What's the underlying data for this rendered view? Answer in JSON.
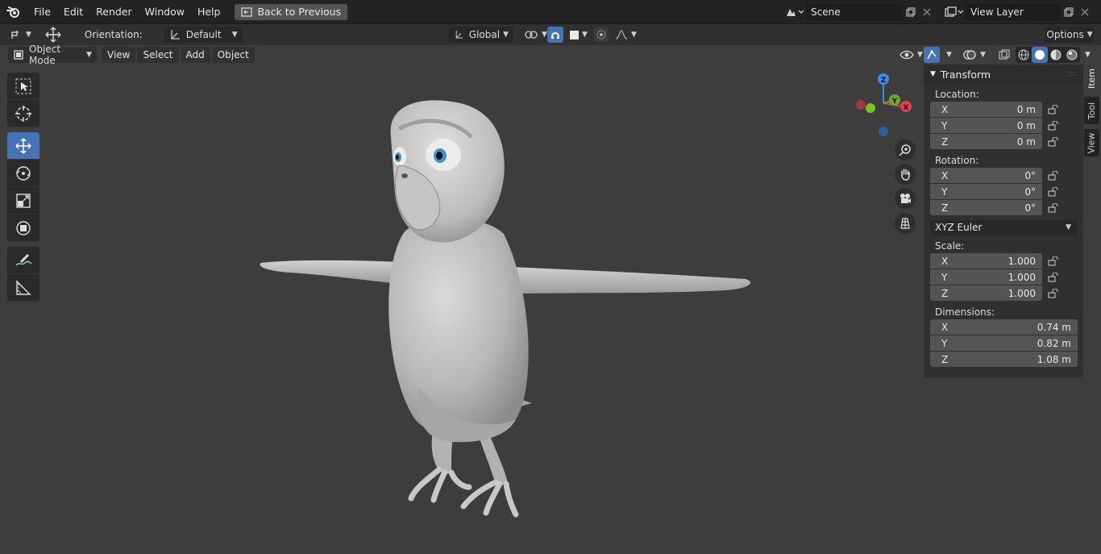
{
  "topbar": {
    "menus": [
      "File",
      "Edit",
      "Render",
      "Window",
      "Help"
    ],
    "back_button": "Back to Previous",
    "scene_value": "Scene",
    "view_layer_value": "View Layer"
  },
  "tool_header": {
    "orientation_label": "Orientation:",
    "orientation_value": "Default",
    "transform_space": "Global",
    "options_label": "Options"
  },
  "viewport_header": {
    "mode": "Object Mode",
    "menus": [
      "View",
      "Select",
      "Add",
      "Object"
    ]
  },
  "gizmo": {
    "z": "Z",
    "y": "Y",
    "x": "X"
  },
  "npanel": {
    "title": "Transform",
    "location_label": "Location:",
    "location": [
      {
        "axis": "X",
        "value": "0 m"
      },
      {
        "axis": "Y",
        "value": "0 m"
      },
      {
        "axis": "Z",
        "value": "0 m"
      }
    ],
    "rotation_label": "Rotation:",
    "rotation": [
      {
        "axis": "X",
        "value": "0°"
      },
      {
        "axis": "Y",
        "value": "0°"
      },
      {
        "axis": "Z",
        "value": "0°"
      }
    ],
    "rotation_mode": "XYZ Euler",
    "scale_label": "Scale:",
    "scale": [
      {
        "axis": "X",
        "value": "1.000"
      },
      {
        "axis": "Y",
        "value": "1.000"
      },
      {
        "axis": "Z",
        "value": "1.000"
      }
    ],
    "dimensions_label": "Dimensions:",
    "dimensions": [
      {
        "axis": "X",
        "value": "0.74 m"
      },
      {
        "axis": "Y",
        "value": "0.82 m"
      },
      {
        "axis": "Z",
        "value": "1.08 m"
      }
    ]
  },
  "side_tabs": [
    "Item",
    "Tool",
    "View"
  ],
  "icons": {
    "toolbar": [
      "select-box-icon",
      "cursor-icon",
      "move-icon",
      "rotate-icon",
      "scale-icon",
      "transform-icon",
      "annotate-icon",
      "measure-icon"
    ],
    "nav": [
      "zoom-icon",
      "hand-pan-icon",
      "camera-icon",
      "grid-ortho-icon"
    ]
  },
  "colors": {
    "accent": "#4772b3",
    "axis_x": "#e8434b",
    "axis_y": "#6ba82c",
    "axis_z": "#3f8ce8"
  }
}
